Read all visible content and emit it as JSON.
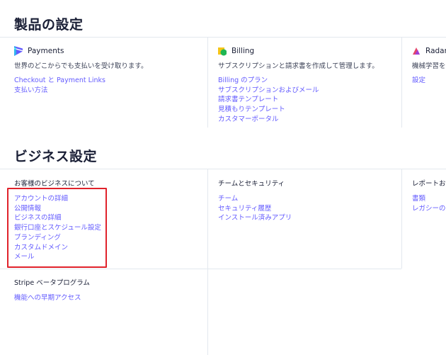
{
  "product_settings": {
    "title": "製品の設定",
    "cards": [
      {
        "name": "Payments",
        "description": "世界のどこからでも支払いを受け取ります。",
        "links": [
          "Checkout と Payment Links",
          "支払い方法"
        ]
      },
      {
        "name": "Billing",
        "description": "サブスクリプションと請求書を作成して管理します。",
        "links": [
          "Billing のプラン",
          "サブスクリプションおよびメール",
          "請求書テンプレート",
          "見積もりテンプレート",
          "カスタマーポータル"
        ]
      },
      {
        "name": "Radar",
        "description": "機械学習を",
        "links": [
          "設定"
        ]
      }
    ]
  },
  "business_settings": {
    "title": "ビジネス設定",
    "sections": [
      {
        "title": "お客様のビジネスについて",
        "links": [
          "アカウントの詳細",
          "公開情報",
          "ビジネスの詳細",
          "銀行口座とスケジュール設定",
          "ブランディング",
          "カスタムドメイン",
          "メール"
        ]
      },
      {
        "title": "チームとセキュリティ",
        "links": [
          "チーム",
          "セキュリティ履歴",
          "インストール済みアプリ"
        ]
      },
      {
        "title": "レポートお",
        "links": [
          "書類",
          "レガシーの"
        ]
      },
      {
        "title": "Stripe ベータプログラム",
        "links": [
          "機能への早期アクセス"
        ]
      }
    ]
  },
  "colors": {
    "link": "#635bff",
    "text": "#1a1f36",
    "divider": "#e3e8ee",
    "highlight_box": "#e0222b",
    "payments_logo": "#635bff",
    "billing_logo_yellow": "#f5c518",
    "billing_logo_green": "#1fb653",
    "radar_logo": "#e5466b"
  },
  "icons": [
    "payments-logo-icon",
    "billing-logo-icon",
    "radar-logo-icon"
  ]
}
